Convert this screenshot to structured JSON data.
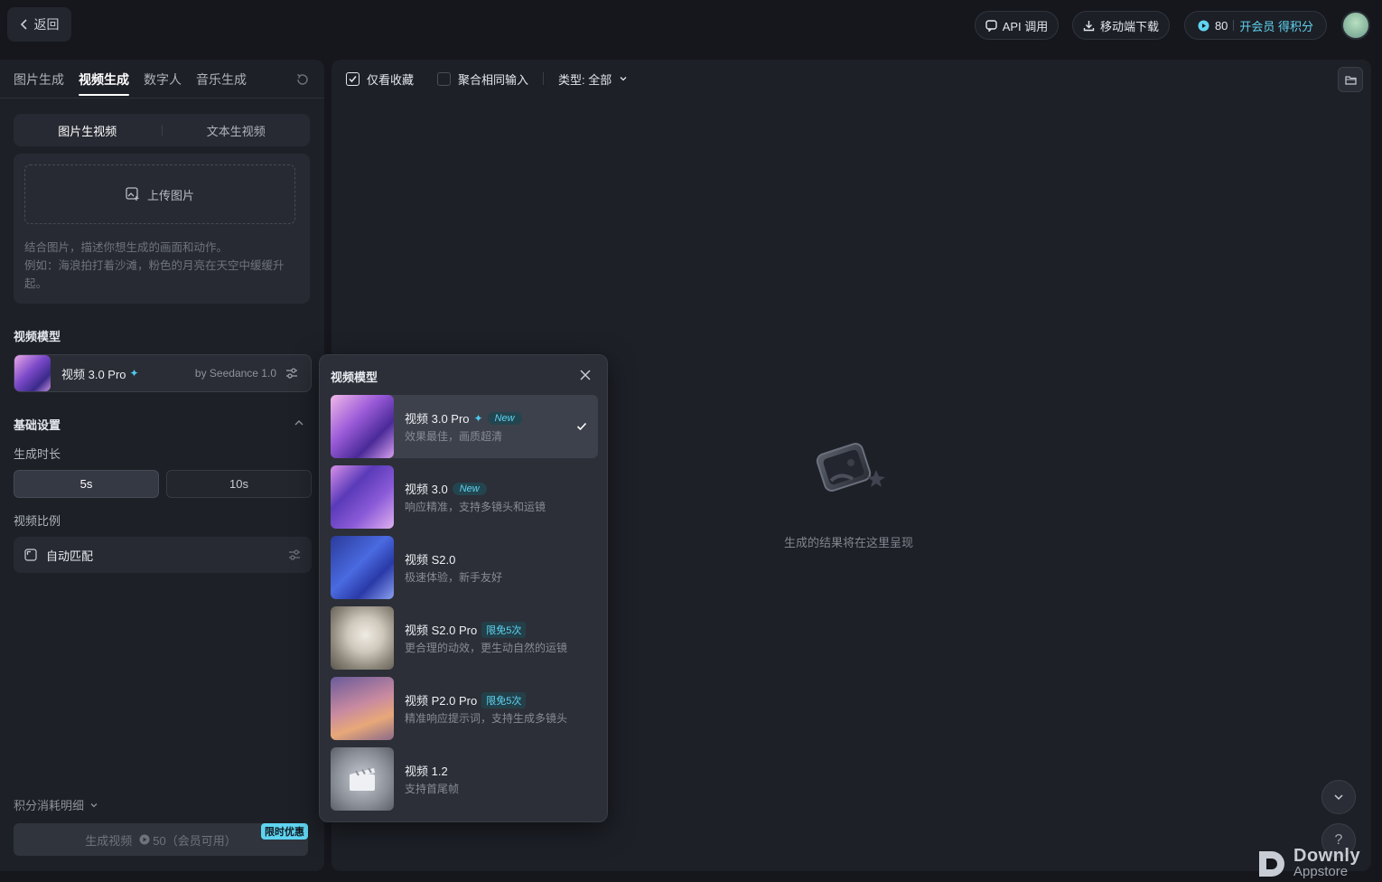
{
  "topbar": {
    "back_label": "返回",
    "api_label": "API 调用",
    "mobile_label": "移动端下载",
    "credits_value": "80",
    "credits_link": "开会员 得积分"
  },
  "tabs": [
    {
      "label": "图片生成"
    },
    {
      "label": "视频生成",
      "active": true
    },
    {
      "label": "数字人"
    },
    {
      "label": "音乐生成"
    }
  ],
  "mode_seg": {
    "image_to_video": "图片生视频",
    "text_to_video": "文本生视频"
  },
  "prompt": {
    "upload_label": "上传图片",
    "hint_line1": "结合图片，描述你想生成的画面和动作。",
    "hint_line2": "例如：海浪拍打着沙滩，粉色的月亮在天空中缓缓升起。"
  },
  "model_section": {
    "title": "视频模型",
    "selected_name": "视频 3.0 Pro",
    "selected_by": "by Seedance 1.0"
  },
  "basic": {
    "title": "基础设置",
    "duration_label": "生成时长",
    "durations": [
      "5s",
      "10s"
    ],
    "ratio_label": "视频比例",
    "ratio_value": "自动匹配"
  },
  "footer": {
    "cost_detail": "积分消耗明细",
    "generate_label": "生成视频",
    "generate_cost": "50（会员可用）",
    "promo_badge": "限时优惠"
  },
  "filters": {
    "favorites_only": "仅看收藏",
    "group_same": "聚合相同输入",
    "type_label": "类型: 全部"
  },
  "empty_state": "生成的结果将在这里呈现",
  "watermark": {
    "main": "Downly",
    "sub": "Appstore"
  },
  "popover": {
    "title": "视频模型",
    "options": [
      {
        "name": "视频 3.0 Pro",
        "badge": "New",
        "badge_type": "new",
        "sparkle": true,
        "desc": "效果最佳，画质超清",
        "selected": true
      },
      {
        "name": "视频 3.0",
        "badge": "New",
        "badge_type": "new",
        "desc": "响应精准，支持多镜头和运镜"
      },
      {
        "name": "视频 S2.0",
        "badge": "",
        "desc": "极速体验，新手友好"
      },
      {
        "name": "视频 S2.0 Pro",
        "badge": "限免5次",
        "badge_type": "free",
        "desc": "更合理的动效，更生动自然的运镜"
      },
      {
        "name": "视频 P2.0 Pro",
        "badge": "限免5次",
        "badge_type": "free",
        "desc": "精准响应提示词，支持生成多镜头"
      },
      {
        "name": "视频 1.2",
        "badge": "",
        "desc": "支持首尾帧"
      }
    ]
  },
  "icons": {
    "back": "chevron-left-icon",
    "api": "chat-bubble-icon",
    "download": "download-icon",
    "credit": "coin-icon",
    "reset": "refresh-icon",
    "upload": "image-add-icon",
    "settings": "sliders-icon",
    "folder": "folder-icon",
    "close": "close-icon",
    "check": "check-icon"
  },
  "colors": {
    "accent": "#5fd3f0",
    "background": "#15171d",
    "panel": "#1d2027"
  }
}
